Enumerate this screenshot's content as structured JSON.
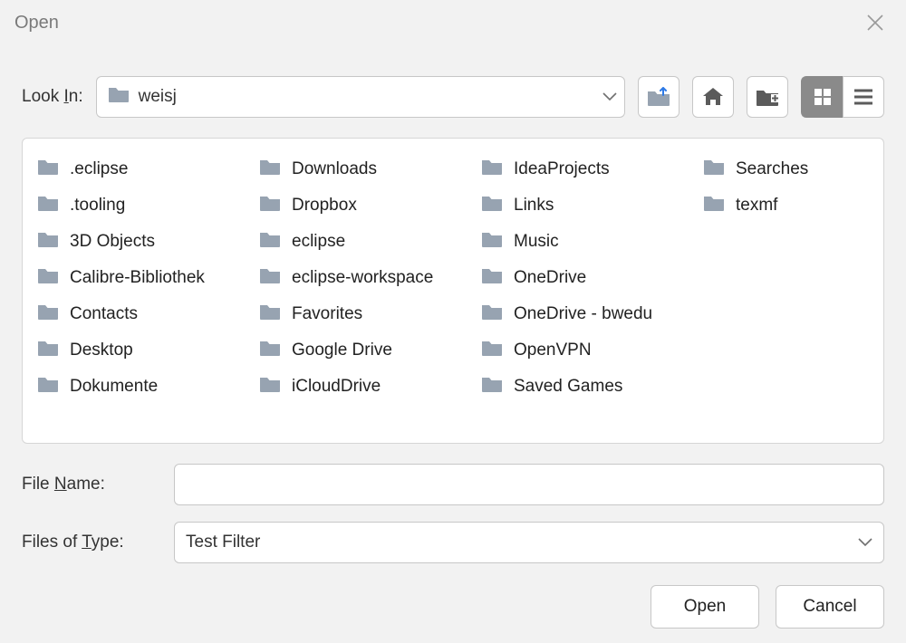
{
  "title": "Open",
  "lookin_label_pre": "Look ",
  "lookin_label_ul": "I",
  "lookin_label_post": "n:",
  "lookin_value": "weisj",
  "files": {
    "col1": [
      ".eclipse",
      ".tooling",
      "3D Objects",
      "Calibre-Bibliothek",
      "Contacts",
      "Desktop",
      "Dokumente",
      "Downloads"
    ],
    "col2": [
      "Dropbox",
      "eclipse",
      "eclipse-workspace",
      "Favorites",
      "Google Drive",
      "iCloudDrive",
      "IdeaProjects",
      "Links"
    ],
    "col3": [
      "Music",
      "OneDrive",
      "OneDrive - bwedu",
      "OpenVPN",
      "Saved Games",
      "Searches",
      "texmf"
    ]
  },
  "filename_label_pre": "File ",
  "filename_label_ul": "N",
  "filename_label_post": "ame:",
  "filename_value": "",
  "filetype_label_pre": "Files of ",
  "filetype_label_ul": "T",
  "filetype_label_post": "ype:",
  "filetype_value": "Test Filter",
  "open_btn": "Open",
  "cancel_btn": "Cancel"
}
